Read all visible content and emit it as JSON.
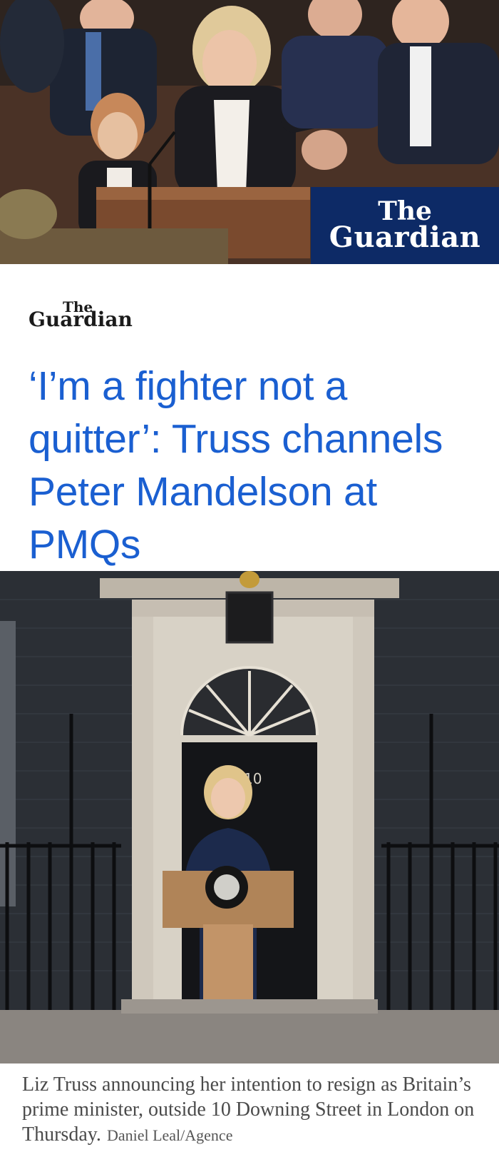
{
  "top_image": {
    "alt": "Liz Truss speaking at the despatch box in the House of Commons",
    "brand_line1": "The",
    "brand_line2": "Guardian"
  },
  "article": {
    "logo_line1": "The",
    "logo_line2": "Guardian",
    "headline": "‘I’m a fighter not a quitter’: Truss channels Peter Mandelson at PMQs"
  },
  "bottom_image": {
    "alt": "Liz Truss at a lectern outside 10 Downing Street",
    "door_number": "10"
  },
  "caption": {
    "text": "Liz Truss announcing her intention to resign as Britain’s prime minister, outside 10 Downing Street in London on Thursday.",
    "credit": "Daniel Leal/Agence"
  },
  "colors": {
    "headline": "#1a5fd1",
    "brand_box": "#0d2a66",
    "caption_text": "#4a4a4a"
  }
}
